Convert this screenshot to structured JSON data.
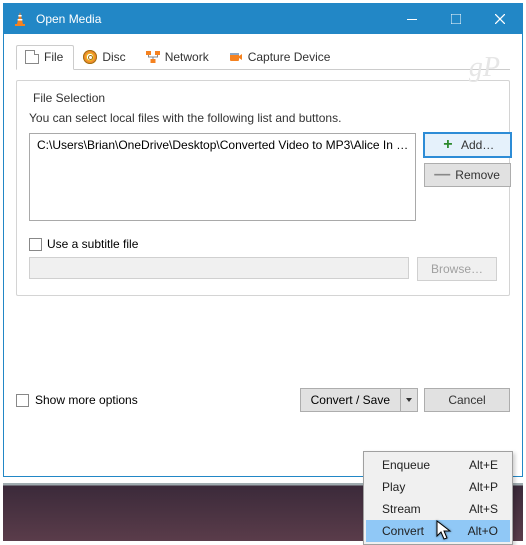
{
  "window": {
    "title": "Open Media"
  },
  "tabs": {
    "file": "File",
    "disc": "Disc",
    "network": "Network",
    "capture": "Capture Device"
  },
  "file_selection": {
    "group_title": "File Selection",
    "hint": "You can select local files with the following list and buttons.",
    "files": [
      "C:\\Users\\Brian\\OneDrive\\Desktop\\Converted Video to MP3\\Alice In …"
    ],
    "add_label": "Add…",
    "remove_label": "Remove"
  },
  "subtitle": {
    "checkbox_label": "Use a subtitle file",
    "browse_label": "Browse…"
  },
  "footer": {
    "show_more": "Show more options",
    "convert_save": "Convert / Save",
    "cancel": "Cancel"
  },
  "menu": {
    "items": [
      {
        "label": "Enqueue",
        "accel": "Alt+E"
      },
      {
        "label": "Play",
        "accel": "Alt+P"
      },
      {
        "label": "Stream",
        "accel": "Alt+S"
      },
      {
        "label": "Convert",
        "accel": "Alt+O",
        "highlight": true
      }
    ]
  },
  "watermark": "gP"
}
